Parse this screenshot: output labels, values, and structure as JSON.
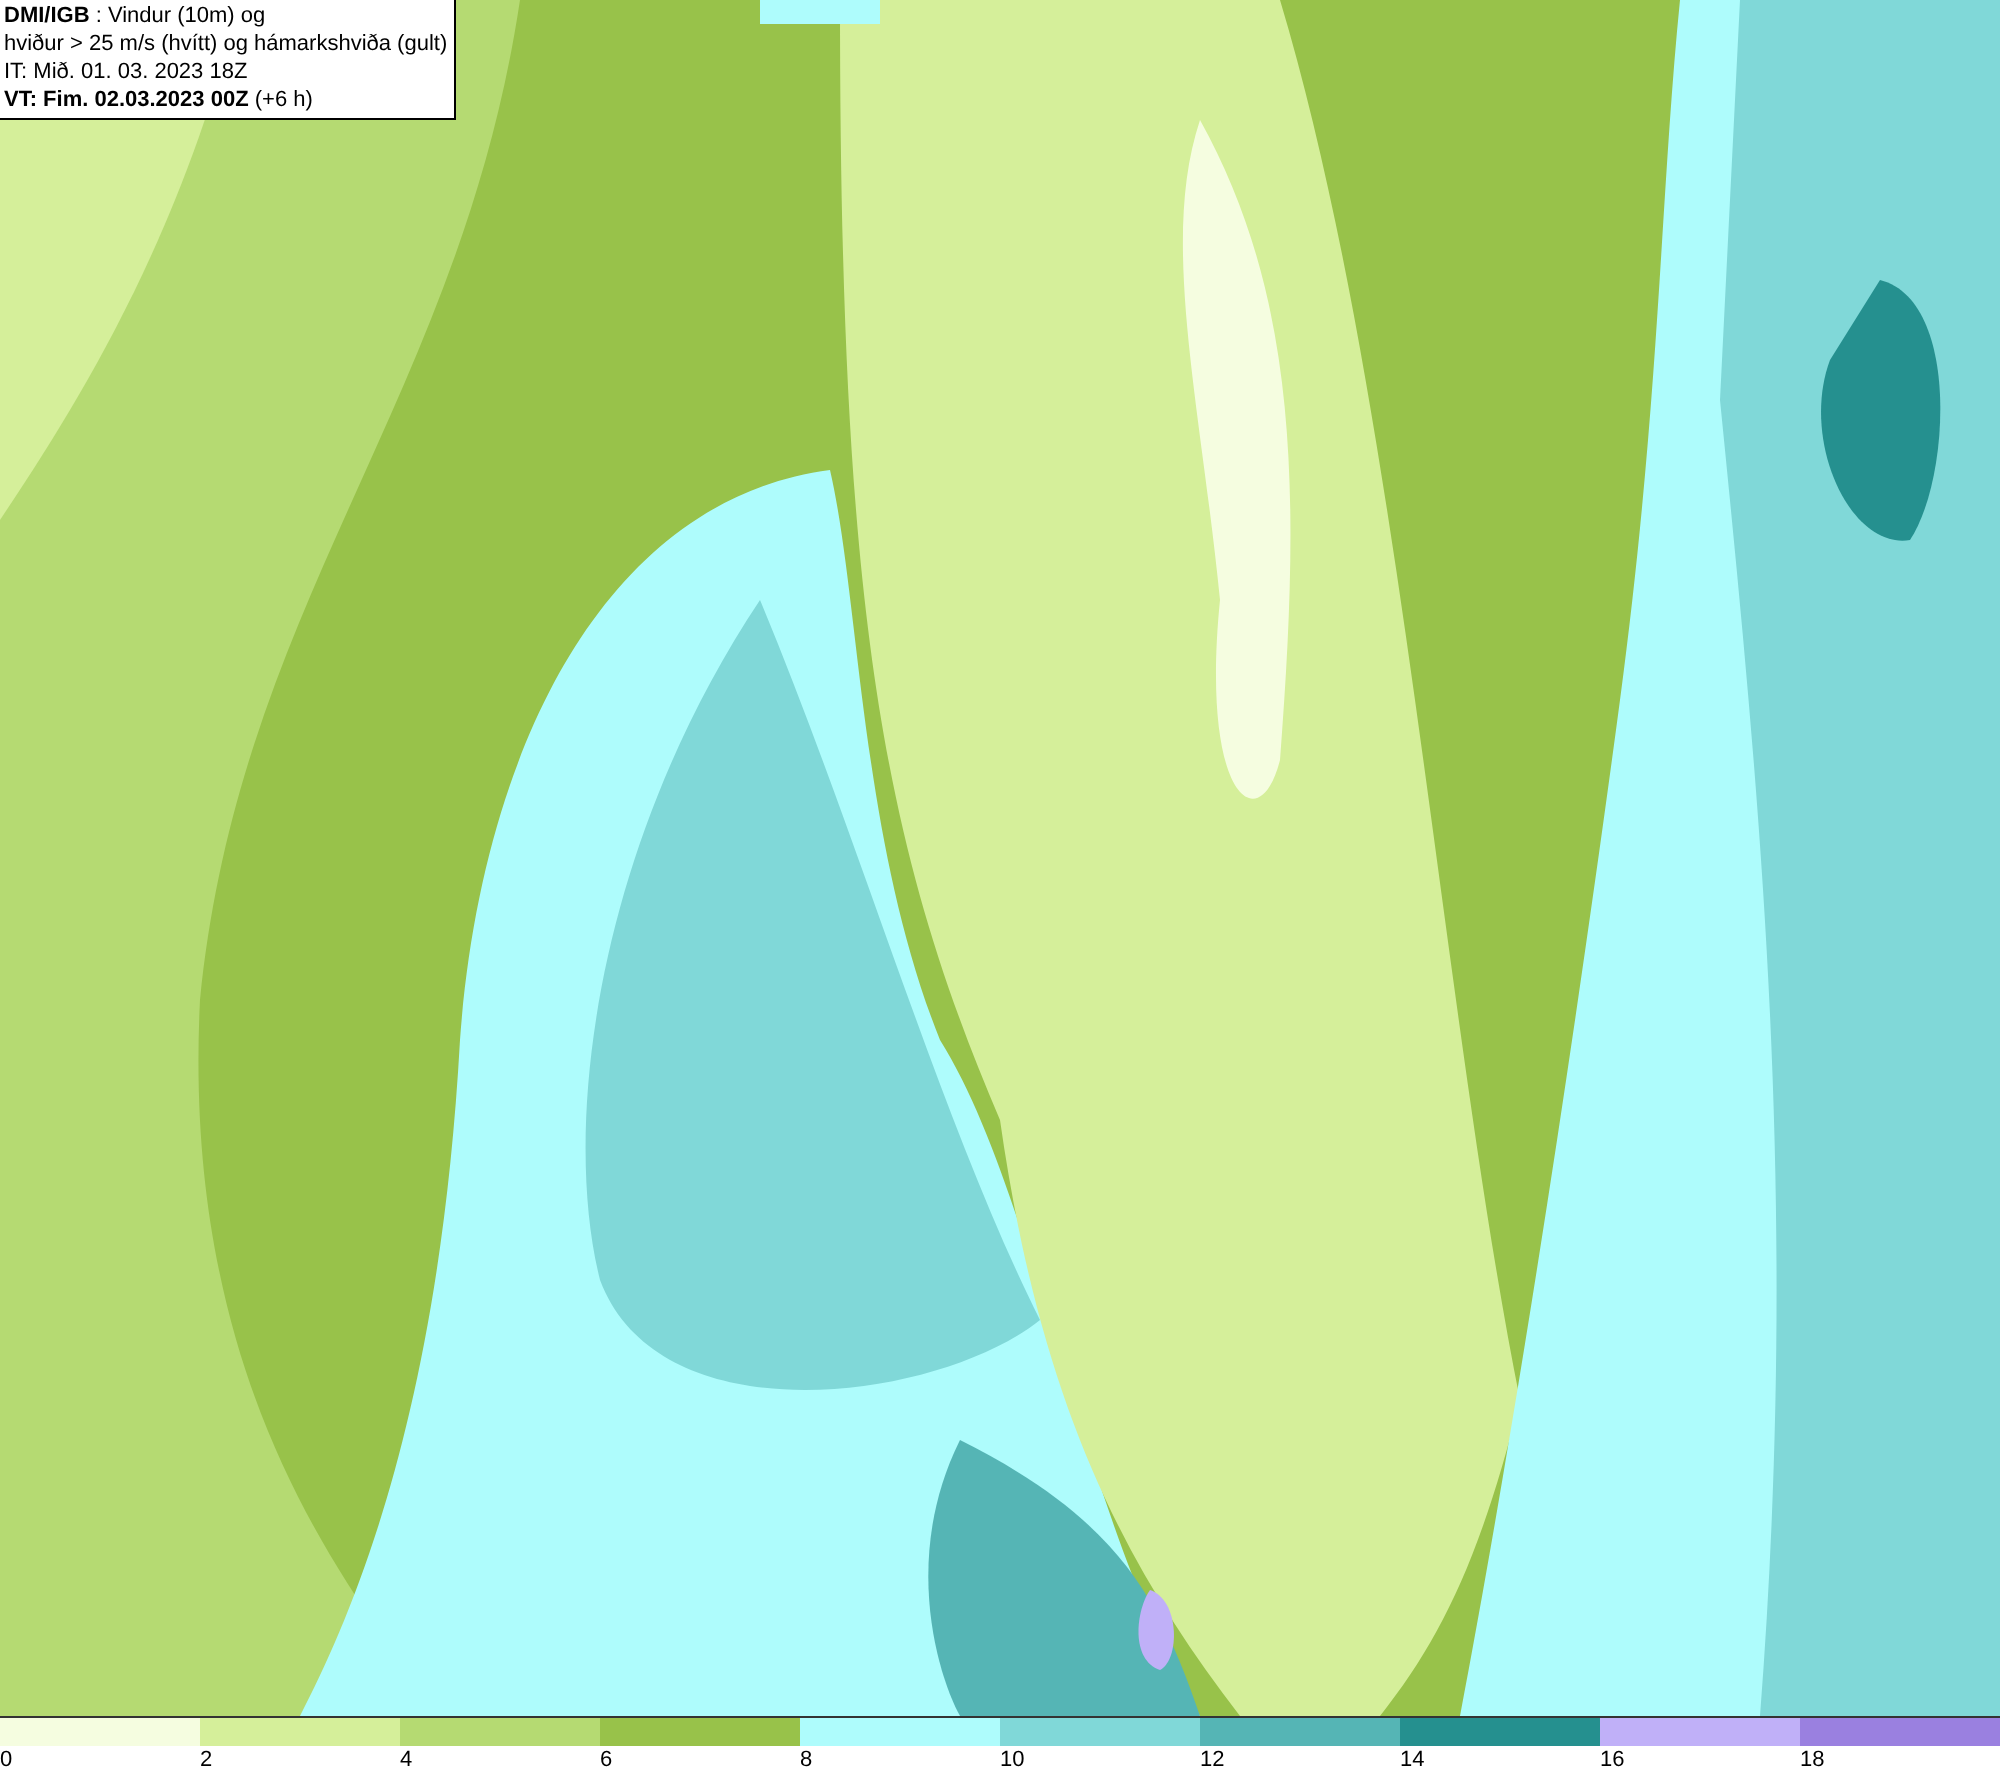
{
  "legend": {
    "lines": [
      "**DMI/IGB** : Vindur (10m) og",
      "hviður > 25 m/s (hvítt) og hámarkshviða (gult)",
      "IT: Mið. 01. 03. 2023 18Z",
      "**VT: Fim. 02.03.2023 00Z** (+6 h)"
    ]
  },
  "colorbar": {
    "bins": [
      {
        "color": "#f5fde0"
      },
      {
        "color": "#d5ef9a"
      },
      {
        "color": "#b5da72"
      },
      {
        "color": "#98c24a"
      },
      {
        "color": "#aefcfc"
      },
      {
        "color": "#80d8d8"
      },
      {
        "color": "#55b5b5"
      },
      {
        "color": "#25908f"
      },
      {
        "color": "#c0b0f8"
      },
      {
        "color": "#9a80e0"
      }
    ],
    "ticks": [
      "0",
      "2",
      "4",
      "6",
      "8",
      "10",
      "12",
      "14",
      "16",
      "18"
    ]
  }
}
